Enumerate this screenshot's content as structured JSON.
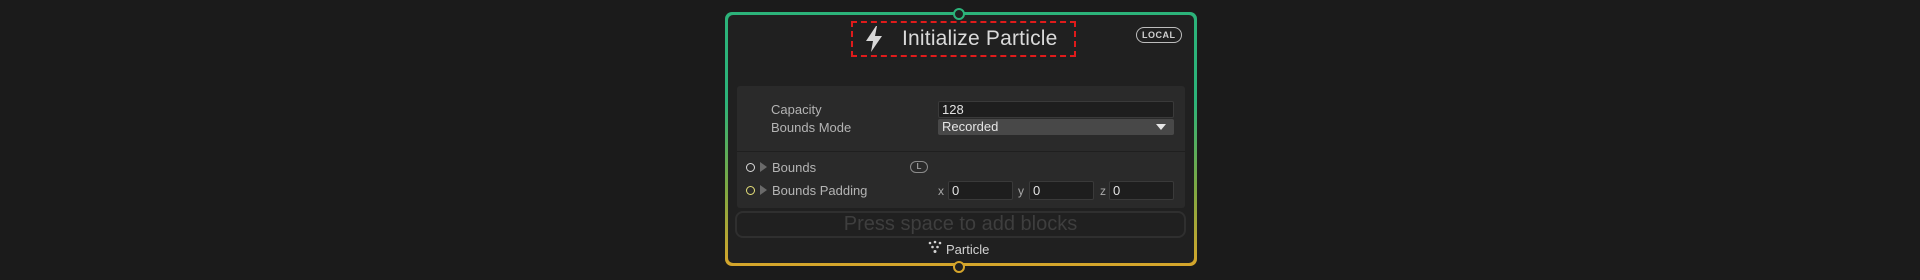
{
  "node": {
    "title": "Initialize Particle",
    "title_icon": "lightning-bolt-icon",
    "space_badge": "LOCAL",
    "colors": {
      "top_accent": "#2cb37a",
      "bottom_accent": "#d5a52b",
      "highlight": "#e01b1b"
    }
  },
  "settings": {
    "capacity_label": "Capacity",
    "capacity_value": "128",
    "bounds_mode_label": "Bounds Mode",
    "bounds_mode_value": "Recorded"
  },
  "properties": {
    "bounds_label": "Bounds",
    "bounds_space_badge": "L",
    "bounds_padding_label": "Bounds Padding",
    "padding_axes": [
      "x",
      "y",
      "z"
    ],
    "padding_values": [
      "0",
      "0",
      "0"
    ]
  },
  "add_blocks_hint": "Press space to add blocks",
  "output": {
    "label": "Particle",
    "icon": "particle-system-icon"
  }
}
